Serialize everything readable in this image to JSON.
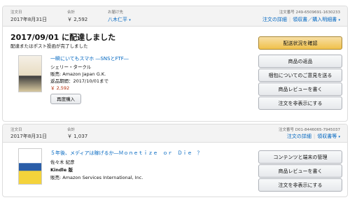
{
  "orders": [
    {
      "date_label": "注文日",
      "date": "2017年8月31日",
      "total_label": "合計",
      "total": "￥ 2,592",
      "ship_label": "お届け先",
      "ship_to": "八木仁平",
      "order_no_label": "注文番号",
      "order_no": "249-6509691-1630233",
      "details_link": "注文の詳細",
      "receipt_link": "領収書／購入明細書",
      "status": "2017/09/01 に配達しました",
      "status_sub": "配達またはポスト投函が完了しました",
      "item": {
        "title": "一瞬にいてもスマホ ―SNSとFTF―",
        "author": "シェリー・タークル",
        "seller": "販売: Amazon Japan G.K.",
        "return_window": "返品期間：2017/10/01まで",
        "price": "￥ 2,592",
        "buy_again": "再度購入"
      },
      "actions": [
        "配送状況を確認",
        "商品の返品",
        "梱包についてのご意見を送る",
        "商品レビューを書く",
        "注文を非表示にする"
      ]
    },
    {
      "date_label": "注文日",
      "date": "2017年8月31日",
      "total_label": "合計",
      "total": "￥ 1,037",
      "order_no_label": "注文番号",
      "order_no": "D01-8446065-7945037",
      "details_link": "注文の詳細",
      "receipt_link": "領収書等",
      "item": {
        "title": "５年後、メディアは稼げるか―Ｍｏｎｅｔｉｚｅ　ｏｒ　Ｄｉｅ　？",
        "author": "佐々木 紀彦",
        "format": "Kindle 版",
        "seller": "販売: Amazon Services International, Inc."
      },
      "actions": [
        "コンテンツと端末の管理",
        "商品レビューを書く",
        "注文を非表示にする"
      ]
    }
  ]
}
